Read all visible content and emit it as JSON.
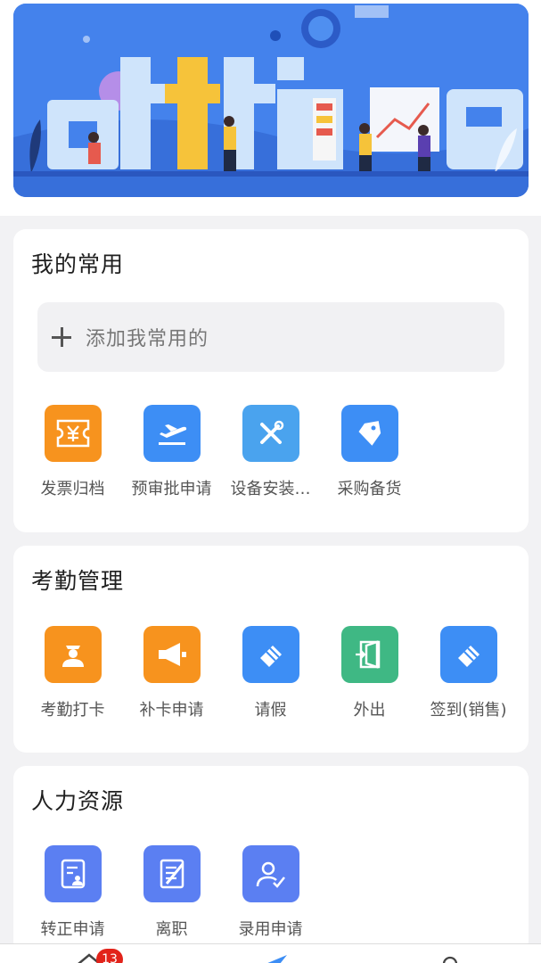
{
  "banner": {
    "word": "office",
    "alt": "office-banner-illustration"
  },
  "sections": {
    "favorites": {
      "title": "我的常用",
      "add_label": "添加我常用的",
      "items": [
        {
          "label": "发票归档",
          "icon": "ticket-yen-icon",
          "color": "#f7931e"
        },
        {
          "label": "预审批申请",
          "icon": "airplane-takeoff-icon",
          "color": "#3d8ef5"
        },
        {
          "label": "设备安装…",
          "icon": "tools-icon",
          "color": "#4aa3ee"
        },
        {
          "label": "采购备货",
          "icon": "price-tag-icon",
          "color": "#3d8ef5"
        }
      ]
    },
    "attendance": {
      "title": "考勤管理",
      "items": [
        {
          "label": "考勤打卡",
          "icon": "guard-person-icon",
          "color": "#f7931e"
        },
        {
          "label": "补卡申请",
          "icon": "megaphone-icon",
          "color": "#f7931e"
        },
        {
          "label": "请假",
          "icon": "eraser-icon",
          "color": "#3d8ef5"
        },
        {
          "label": "外出",
          "icon": "door-exit-icon",
          "color": "#3fb884"
        },
        {
          "label": "签到(销售)",
          "icon": "eraser-icon",
          "color": "#3d8ef5"
        }
      ]
    },
    "hr": {
      "title": "人力资源",
      "items": [
        {
          "label": "转正申请",
          "icon": "id-document-icon",
          "color": "#5b7ff2"
        },
        {
          "label": "离职",
          "icon": "signed-document-icon",
          "color": "#5b7ff2"
        },
        {
          "label": "录用申请",
          "icon": "user-check-icon",
          "color": "#5b7ff2"
        }
      ]
    }
  },
  "tabbar": {
    "badge_count": "13"
  }
}
